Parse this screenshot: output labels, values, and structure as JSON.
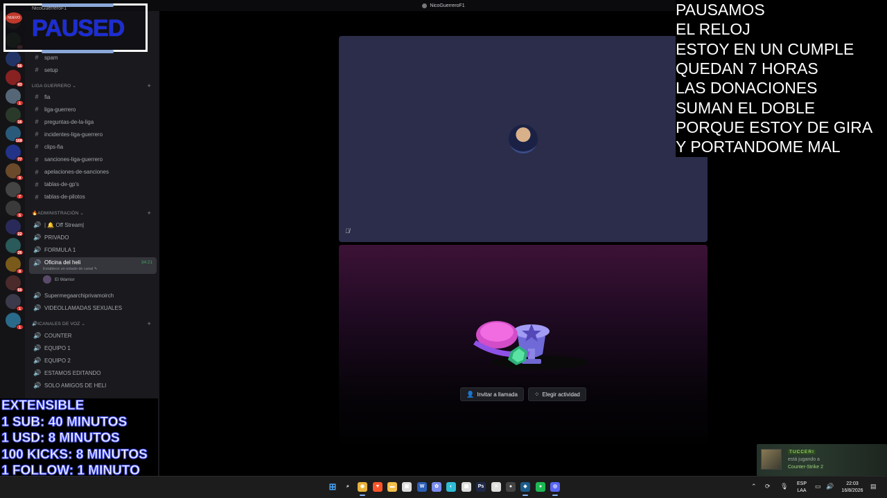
{
  "window": {
    "title": "NicoGuerreroF1"
  },
  "paused_overlay": {
    "text": "PAUSED",
    "top_small": "NicoGuerreroF1",
    "badge": "NUEVO"
  },
  "rail": {
    "servers": [
      {
        "color": "#5a3a2a",
        "badge": ""
      },
      {
        "color": "#3a5a3a",
        "badge": "60"
      },
      {
        "color": "#223366",
        "badge": "56"
      },
      {
        "color": "#882222",
        "badge": "43"
      },
      {
        "color": "#556677",
        "badge": "1"
      },
      {
        "color": "#2a3a2a",
        "badge": "16"
      },
      {
        "color": "#2a5a7a",
        "badge": "168"
      },
      {
        "color": "#223388",
        "badge": "77"
      },
      {
        "color": "#6a4a2a",
        "badge": "9"
      },
      {
        "color": "#444444",
        "badge": "7"
      },
      {
        "color": "#3a3a3a",
        "badge": "5"
      },
      {
        "color": "#2a2a5a",
        "badge": "22"
      },
      {
        "color": "#2a5a5a",
        "badge": "26"
      },
      {
        "color": "#7a5a1a",
        "badge": "8"
      },
      {
        "color": "#4a2a2a",
        "badge": "50"
      },
      {
        "color": "#3a3a4a",
        "badge": "1"
      },
      {
        "color": "#2a6a8a",
        "badge": "1"
      }
    ]
  },
  "sidebar": {
    "top_channels": [
      {
        "label": "spam",
        "icon": "#"
      },
      {
        "label": "setup",
        "icon": "#"
      }
    ],
    "cat_liga": {
      "label": "LIGA GUERRERO ⌄"
    },
    "liga_channels": [
      {
        "label": "fia"
      },
      {
        "label": "liga-guerrero"
      },
      {
        "label": "preguntas-de-la-liga"
      },
      {
        "label": "incidentes-liga-guerrero"
      },
      {
        "label": "clips-fia"
      },
      {
        "label": "sanciones-liga-guerrero"
      },
      {
        "label": "apelaciones-de-sanciones"
      },
      {
        "label": "tablas-de-gp's"
      },
      {
        "label": "tablas-de-pilotos"
      }
    ],
    "cat_admin": {
      "label": "🔥ADMINISTRACIÓN ⌄"
    },
    "admin_channels": [
      {
        "label": "| 🔔 Off Stream|"
      },
      {
        "label": "PRIVADO"
      },
      {
        "label": "FORMULA 1"
      }
    ],
    "active_channel": {
      "label": "Oficina del heli",
      "status": "Establece un estado de canal ✎",
      "timer": "34:21"
    },
    "member": {
      "name": "El Warrior"
    },
    "more_voice": [
      {
        "label": "Supermegaarchiprivamoirch"
      },
      {
        "label": "VIDEOLLAMADAS SEXUALES"
      }
    ],
    "cat_voz": {
      "label": "🔊ICANALES DE VOZ ⌄"
    },
    "voz_channels": [
      {
        "label": "COUNTER"
      },
      {
        "label": "EQUIPO 1"
      },
      {
        "label": "EQUIPO 2"
      },
      {
        "label": "ESTAMOS EDITANDO"
      },
      {
        "label": "SOLO AMIGOS DE HELI"
      }
    ]
  },
  "timer_overlay": {
    "lines": [
      "EXTENSIBLE",
      "1 SUB: 40 MINUTOS",
      "1 USD: 8 MINUTOS",
      "100 KICKS: 8 MINUTOS",
      "1 FOLLOW: 1 MINUTO"
    ]
  },
  "overlay_text": {
    "lines": [
      "PAUSAMOS",
      "EL RELOJ",
      "ESTOY EN UN CUMPLE",
      "QUEDAN 7 HORAS",
      "LAS DONACIONES",
      "SUMAN EL DOBLE",
      "PORQUE ESTOY DE GIRA",
      "Y PORTANDOME MAL"
    ]
  },
  "call": {
    "invite_label": "Invitar a llamada",
    "activity_label": "Elegir actividad"
  },
  "notification": {
    "name": "TUCCERI",
    "playing": "está jugando a",
    "game": "Counter-Strike 2"
  },
  "taskbar": {
    "apps": [
      {
        "name": "windows-start",
        "glyph": "⊞",
        "color": "#4aa3f0"
      },
      {
        "name": "search",
        "glyph": "⌕",
        "color": "#dddddd"
      },
      {
        "name": "chrome",
        "glyph": "◉",
        "color": "#e8b33a"
      },
      {
        "name": "brave",
        "glyph": "▼",
        "color": "#fb542b"
      },
      {
        "name": "explorer",
        "glyph": "▬",
        "color": "#f3c04a"
      },
      {
        "name": "terminal",
        "glyph": "▣",
        "color": "#dddddd"
      },
      {
        "name": "word",
        "glyph": "W",
        "color": "#2b5fb8"
      },
      {
        "name": "copilot",
        "glyph": "✿",
        "color": "#7a8cf0"
      },
      {
        "name": "edge",
        "glyph": "◐",
        "color": "#2fbcd6"
      },
      {
        "name": "calculator",
        "glyph": "▦",
        "color": "#dddddd"
      },
      {
        "name": "photoshop",
        "glyph": "Ps",
        "color": "#1f2a4a"
      },
      {
        "name": "capcut",
        "glyph": "✕",
        "color": "#dddddd"
      },
      {
        "name": "obs",
        "glyph": "●",
        "color": "#444444"
      },
      {
        "name": "steam",
        "glyph": "◈",
        "color": "#1b5b8a"
      },
      {
        "name": "spotify",
        "glyph": "●",
        "color": "#1db954"
      },
      {
        "name": "discord",
        "glyph": "◎",
        "color": "#5865f2"
      }
    ],
    "lang_top": "ESP",
    "lang_bottom": "LAA",
    "time": "22:03",
    "date": "16/8/2026"
  }
}
